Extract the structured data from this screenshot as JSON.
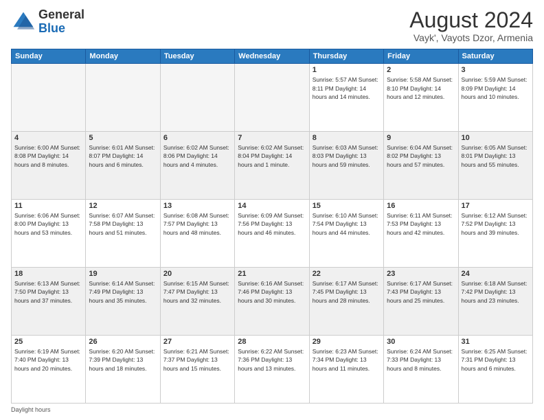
{
  "logo": {
    "general": "General",
    "blue": "Blue"
  },
  "header": {
    "month_year": "August 2024",
    "location": "Vayk', Vayots Dzor, Armenia"
  },
  "days_of_week": [
    "Sunday",
    "Monday",
    "Tuesday",
    "Wednesday",
    "Thursday",
    "Friday",
    "Saturday"
  ],
  "footer": {
    "daylight_label": "Daylight hours"
  },
  "weeks": [
    [
      {
        "day": "",
        "info": ""
      },
      {
        "day": "",
        "info": ""
      },
      {
        "day": "",
        "info": ""
      },
      {
        "day": "",
        "info": ""
      },
      {
        "day": "1",
        "info": "Sunrise: 5:57 AM\nSunset: 8:11 PM\nDaylight: 14 hours\nand 14 minutes."
      },
      {
        "day": "2",
        "info": "Sunrise: 5:58 AM\nSunset: 8:10 PM\nDaylight: 14 hours\nand 12 minutes."
      },
      {
        "day": "3",
        "info": "Sunrise: 5:59 AM\nSunset: 8:09 PM\nDaylight: 14 hours\nand 10 minutes."
      }
    ],
    [
      {
        "day": "4",
        "info": "Sunrise: 6:00 AM\nSunset: 8:08 PM\nDaylight: 14 hours\nand 8 minutes."
      },
      {
        "day": "5",
        "info": "Sunrise: 6:01 AM\nSunset: 8:07 PM\nDaylight: 14 hours\nand 6 minutes."
      },
      {
        "day": "6",
        "info": "Sunrise: 6:02 AM\nSunset: 8:06 PM\nDaylight: 14 hours\nand 4 minutes."
      },
      {
        "day": "7",
        "info": "Sunrise: 6:02 AM\nSunset: 8:04 PM\nDaylight: 14 hours\nand 1 minute."
      },
      {
        "day": "8",
        "info": "Sunrise: 6:03 AM\nSunset: 8:03 PM\nDaylight: 13 hours\nand 59 minutes."
      },
      {
        "day": "9",
        "info": "Sunrise: 6:04 AM\nSunset: 8:02 PM\nDaylight: 13 hours\nand 57 minutes."
      },
      {
        "day": "10",
        "info": "Sunrise: 6:05 AM\nSunset: 8:01 PM\nDaylight: 13 hours\nand 55 minutes."
      }
    ],
    [
      {
        "day": "11",
        "info": "Sunrise: 6:06 AM\nSunset: 8:00 PM\nDaylight: 13 hours\nand 53 minutes."
      },
      {
        "day": "12",
        "info": "Sunrise: 6:07 AM\nSunset: 7:58 PM\nDaylight: 13 hours\nand 51 minutes."
      },
      {
        "day": "13",
        "info": "Sunrise: 6:08 AM\nSunset: 7:57 PM\nDaylight: 13 hours\nand 48 minutes."
      },
      {
        "day": "14",
        "info": "Sunrise: 6:09 AM\nSunset: 7:56 PM\nDaylight: 13 hours\nand 46 minutes."
      },
      {
        "day": "15",
        "info": "Sunrise: 6:10 AM\nSunset: 7:54 PM\nDaylight: 13 hours\nand 44 minutes."
      },
      {
        "day": "16",
        "info": "Sunrise: 6:11 AM\nSunset: 7:53 PM\nDaylight: 13 hours\nand 42 minutes."
      },
      {
        "day": "17",
        "info": "Sunrise: 6:12 AM\nSunset: 7:52 PM\nDaylight: 13 hours\nand 39 minutes."
      }
    ],
    [
      {
        "day": "18",
        "info": "Sunrise: 6:13 AM\nSunset: 7:50 PM\nDaylight: 13 hours\nand 37 minutes."
      },
      {
        "day": "19",
        "info": "Sunrise: 6:14 AM\nSunset: 7:49 PM\nDaylight: 13 hours\nand 35 minutes."
      },
      {
        "day": "20",
        "info": "Sunrise: 6:15 AM\nSunset: 7:47 PM\nDaylight: 13 hours\nand 32 minutes."
      },
      {
        "day": "21",
        "info": "Sunrise: 6:16 AM\nSunset: 7:46 PM\nDaylight: 13 hours\nand 30 minutes."
      },
      {
        "day": "22",
        "info": "Sunrise: 6:17 AM\nSunset: 7:45 PM\nDaylight: 13 hours\nand 28 minutes."
      },
      {
        "day": "23",
        "info": "Sunrise: 6:17 AM\nSunset: 7:43 PM\nDaylight: 13 hours\nand 25 minutes."
      },
      {
        "day": "24",
        "info": "Sunrise: 6:18 AM\nSunset: 7:42 PM\nDaylight: 13 hours\nand 23 minutes."
      }
    ],
    [
      {
        "day": "25",
        "info": "Sunrise: 6:19 AM\nSunset: 7:40 PM\nDaylight: 13 hours\nand 20 minutes."
      },
      {
        "day": "26",
        "info": "Sunrise: 6:20 AM\nSunset: 7:39 PM\nDaylight: 13 hours\nand 18 minutes."
      },
      {
        "day": "27",
        "info": "Sunrise: 6:21 AM\nSunset: 7:37 PM\nDaylight: 13 hours\nand 15 minutes."
      },
      {
        "day": "28",
        "info": "Sunrise: 6:22 AM\nSunset: 7:36 PM\nDaylight: 13 hours\nand 13 minutes."
      },
      {
        "day": "29",
        "info": "Sunrise: 6:23 AM\nSunset: 7:34 PM\nDaylight: 13 hours\nand 11 minutes."
      },
      {
        "day": "30",
        "info": "Sunrise: 6:24 AM\nSunset: 7:33 PM\nDaylight: 13 hours\nand 8 minutes."
      },
      {
        "day": "31",
        "info": "Sunrise: 6:25 AM\nSunset: 7:31 PM\nDaylight: 13 hours\nand 6 minutes."
      }
    ]
  ]
}
